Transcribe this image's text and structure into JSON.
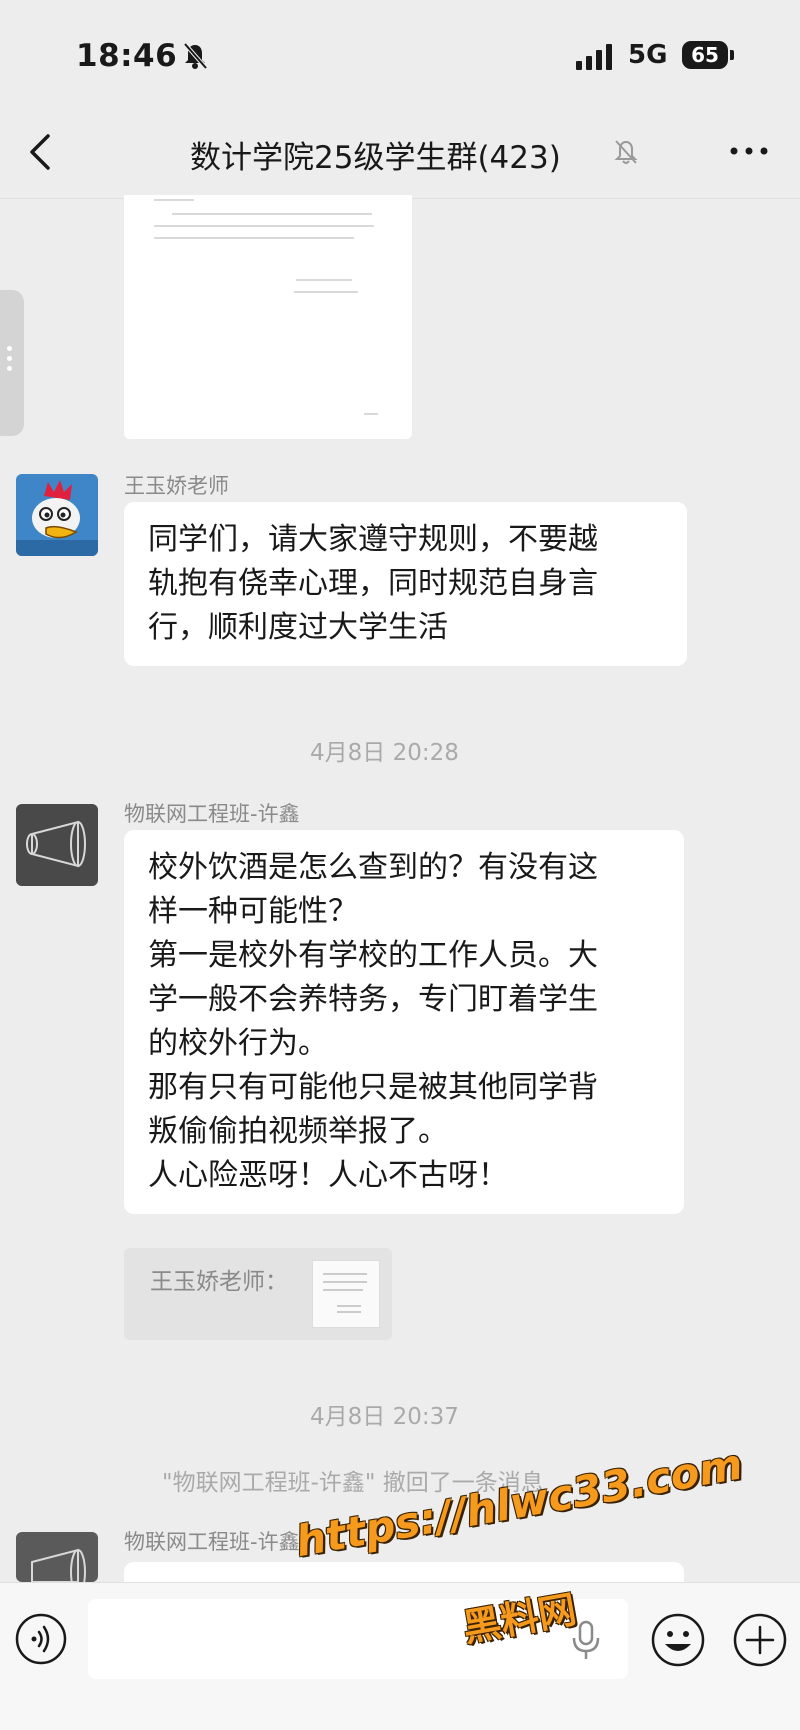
{
  "status_bar": {
    "time": "18:46",
    "network": "5G",
    "battery": "65"
  },
  "header": {
    "title": "数计学院25级学生群(423)"
  },
  "messages": {
    "teacher": {
      "sender": "王玉娇老师",
      "lines": [
        "同学们，请大家遵守规则，不要越",
        "轨抱有侥幸心理，同时规范自身言",
        "行，顺利度过大学生活"
      ]
    },
    "timestamp1": "4月8日 20:28",
    "student": {
      "sender": "物联网工程班-许鑫",
      "lines": [
        "校外饮酒是怎么查到的？有没有这",
        "样一种可能性？",
        "第一是校外有学校的工作人员。大",
        "学一般不会养特务，专门盯着学生",
        "的校外行为。",
        "那有只有可能他只是被其他同学背",
        "叛偷偷拍视频举报了。",
        "人心险恶呀！人心不古呀！"
      ],
      "quote": "王玉娇老师："
    },
    "timestamp2": "4月8日 20:37",
    "recall_notice": "\"物联网工程班-许鑫\" 撤回了一条消息",
    "student2": {
      "sender": "物联网工程班-许鑫"
    }
  },
  "watermark": {
    "url": "https://hlwc33.com",
    "name": "黑料网"
  },
  "colors": {
    "background": "#ededed",
    "bubble": "#ffffff",
    "watermark": "#f59a1c"
  }
}
